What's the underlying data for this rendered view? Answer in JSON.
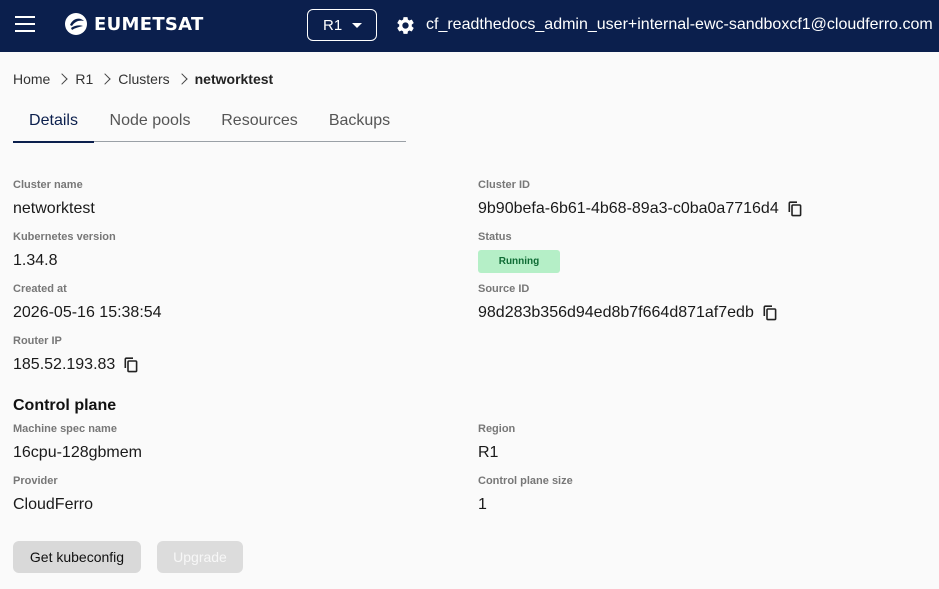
{
  "header": {
    "brand": "EUMETSAT",
    "region": "R1",
    "user_email": "cf_readthedocs_admin_user+internal-ewc-sandboxcf1@cloudferro.com"
  },
  "breadcrumb": [
    "Home",
    "R1",
    "Clusters",
    "networktest"
  ],
  "tabs": [
    "Details",
    "Node pools",
    "Resources",
    "Backups"
  ],
  "details": {
    "cluster_name_label": "Cluster name",
    "cluster_name": "networktest",
    "cluster_id_label": "Cluster ID",
    "cluster_id": "9b90befa-6b61-4b68-89a3-c0ba0a7716d4",
    "k8s_version_label": "Kubernetes version",
    "k8s_version": "1.34.8",
    "status_label": "Status",
    "status": "Running",
    "created_label": "Created at",
    "created": "2026-05-16 15:38:54",
    "source_id_label": "Source ID",
    "source_id": "98d283b356d94ed8b7f664d871af7edb",
    "router_ip_label": "Router IP",
    "router_ip": "185.52.193.83"
  },
  "control_plane": {
    "title": "Control plane",
    "machine_spec_label": "Machine spec name",
    "machine_spec": "16cpu-128gbmem",
    "region_label": "Region",
    "region": "R1",
    "provider_label": "Provider",
    "provider": "CloudFerro",
    "size_label": "Control plane size",
    "size": "1"
  },
  "actions": {
    "kubeconfig": "Get kubeconfig",
    "upgrade": "Upgrade"
  },
  "colors": {
    "header_bg": "#0b1f4d",
    "status_bg": "#b5efc7",
    "status_fg": "#0e6b34"
  }
}
